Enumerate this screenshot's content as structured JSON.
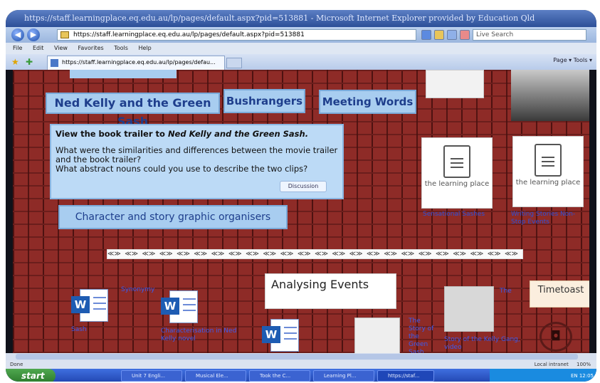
{
  "browser": {
    "title": "https://staff.learningplace.eq.edu.au/lp/pages/default.aspx?pid=513881 - Microsoft Internet Explorer provided by Education Qld",
    "address": "https://staff.learningplace.eq.edu.au/lp/pages/default.aspx?pid=513881",
    "search_placeholder": "Live Search",
    "menu": [
      "File",
      "Edit",
      "View",
      "Favorites",
      "Tools",
      "Help"
    ],
    "tab_label": "https://staff.learningplace.eq.edu.au/lp/pages/defau...",
    "command_bar": "Page ▾  Tools ▾"
  },
  "page": {
    "nav": {
      "ned": "Ned Kelly and the Green Sash",
      "bushrangers": "Bushrangers",
      "meeting": "Meeting Words"
    },
    "trailer": {
      "head_prefix": "View the book trailer to ",
      "head_title": "Ned Kelly and the Green Sash.",
      "line1": "What were the similarities and differences between the movie trailer and the book trailer?",
      "line2": "What abstract nouns could you use to describe the two clips?",
      "button": "Discussion"
    },
    "character_heading": "Character and story graphic organisers",
    "lp_logo_text": "the learning place",
    "lp_card_1_label": "Sensational Sashes",
    "lp_card_2_label": "Writing Stories Non-Stop Events",
    "arrows_strip": "≪≫ ≪≫ ≪≫ ≪≫ ≪≫ ≪≫ ≪≫ ≪≫ ≪≫ ≪≫ ≪≫ ≪≫ ≪≫ ≪≫ ≪≫ ≪≫ ≪≫ ≪≫ ≪≫ ≪≫ ≪≫ ≪≫ ≪≫ ≪≫ ≪≫ ≪≫ ≪≫ ≪≫ ≪≫ ≪≫",
    "analysing_events": "Analysing Events",
    "timetoast": "Timetoast",
    "links": {
      "doc1": "Sash",
      "doc1_side": "Synonymy",
      "doc2": "Characterisation in Ned Kelly novel",
      "doc3": "",
      "thumb1": "The Story of the Green Sash",
      "thumb2_side": "The",
      "thumb2": "Story of the Kelly Gang, video"
    }
  },
  "status": {
    "left": "Done",
    "zone": "Local intranet",
    "zoom": "100%"
  },
  "taskbar": {
    "start": "start",
    "items": [
      "Unit 7 Engli...",
      "Musical Ele...",
      "Took the C...",
      "Learning Pl...",
      "https://staf..."
    ],
    "tray": "EN  12:05"
  }
}
